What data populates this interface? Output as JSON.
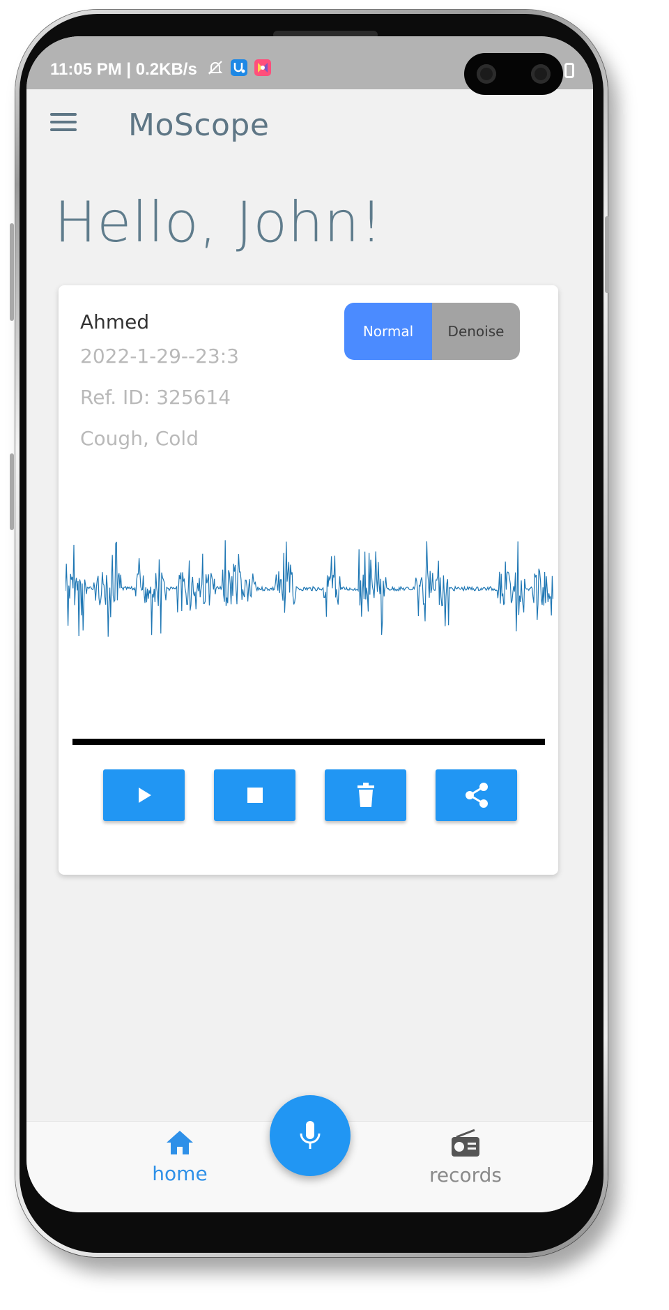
{
  "status_bar": {
    "time_net": "11:05 PM | 0.2KB/s",
    "icons": [
      "bell-off-icon",
      "stethoscope-app-icon",
      "colorful-app-icon"
    ]
  },
  "app_bar": {
    "title": "MoScope",
    "menu_icon": "hamburger-menu-icon"
  },
  "greeting": "Hello, John!",
  "record_card": {
    "patient": "Ahmed",
    "date": "2022-1-29--23:3",
    "ref_id": "Ref. ID: 325614",
    "diagnosis": "Cough, Cold",
    "toggle": {
      "options": [
        "Normal",
        "Denoise"
      ],
      "selected": "Normal"
    },
    "waveform_color": "#1f77b4",
    "controls": [
      {
        "name": "play",
        "icon": "play-icon"
      },
      {
        "name": "stop",
        "icon": "stop-icon"
      },
      {
        "name": "delete",
        "icon": "trash-icon"
      },
      {
        "name": "share",
        "icon": "share-icon"
      }
    ]
  },
  "bottom_nav": {
    "items": [
      {
        "label": "home",
        "icon": "home-icon",
        "active": true
      },
      {
        "label": "records",
        "icon": "radio-icon",
        "active": false
      }
    ],
    "fab_icon": "microphone-icon"
  },
  "colors": {
    "accent": "#2196f3",
    "toggle_active": "#4b8bff",
    "toggle_inactive": "#a3a3a3",
    "title_text": "#5e7685",
    "status_bar_bg": "#b3b3b3",
    "screen_bg": "#f1f1f1"
  }
}
